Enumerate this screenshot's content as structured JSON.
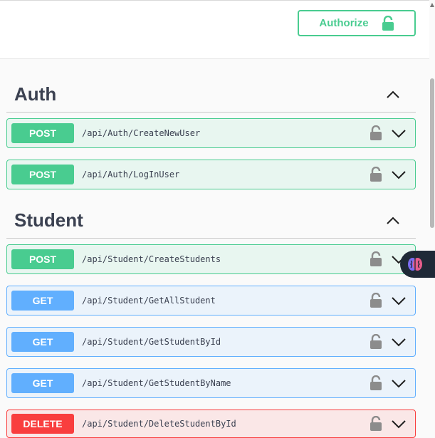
{
  "header": {
    "authorize_label": "Authorize"
  },
  "sections": [
    {
      "title": "Auth",
      "operations": [
        {
          "method": "POST",
          "path": "/api/Auth/CreateNewUser"
        },
        {
          "method": "POST",
          "path": "/api/Auth/LogInUser"
        }
      ]
    },
    {
      "title": "Student",
      "operations": [
        {
          "method": "POST",
          "path": "/api/Student/CreateStudents"
        },
        {
          "method": "GET",
          "path": "/api/Student/GetAllStudent"
        },
        {
          "method": "GET",
          "path": "/api/Student/GetStudentById"
        },
        {
          "method": "GET",
          "path": "/api/Student/GetStudentByName"
        },
        {
          "method": "DELETE",
          "path": "/api/Student/DeleteStudentById"
        }
      ]
    }
  ],
  "colors": {
    "post": "#49cc90",
    "get": "#61affe",
    "delete": "#f93e3e",
    "text": "#3b4151"
  },
  "icons": {
    "lock": "lock-icon",
    "chevron": "chevron-down-icon",
    "collapse": "chevron-up-icon"
  }
}
